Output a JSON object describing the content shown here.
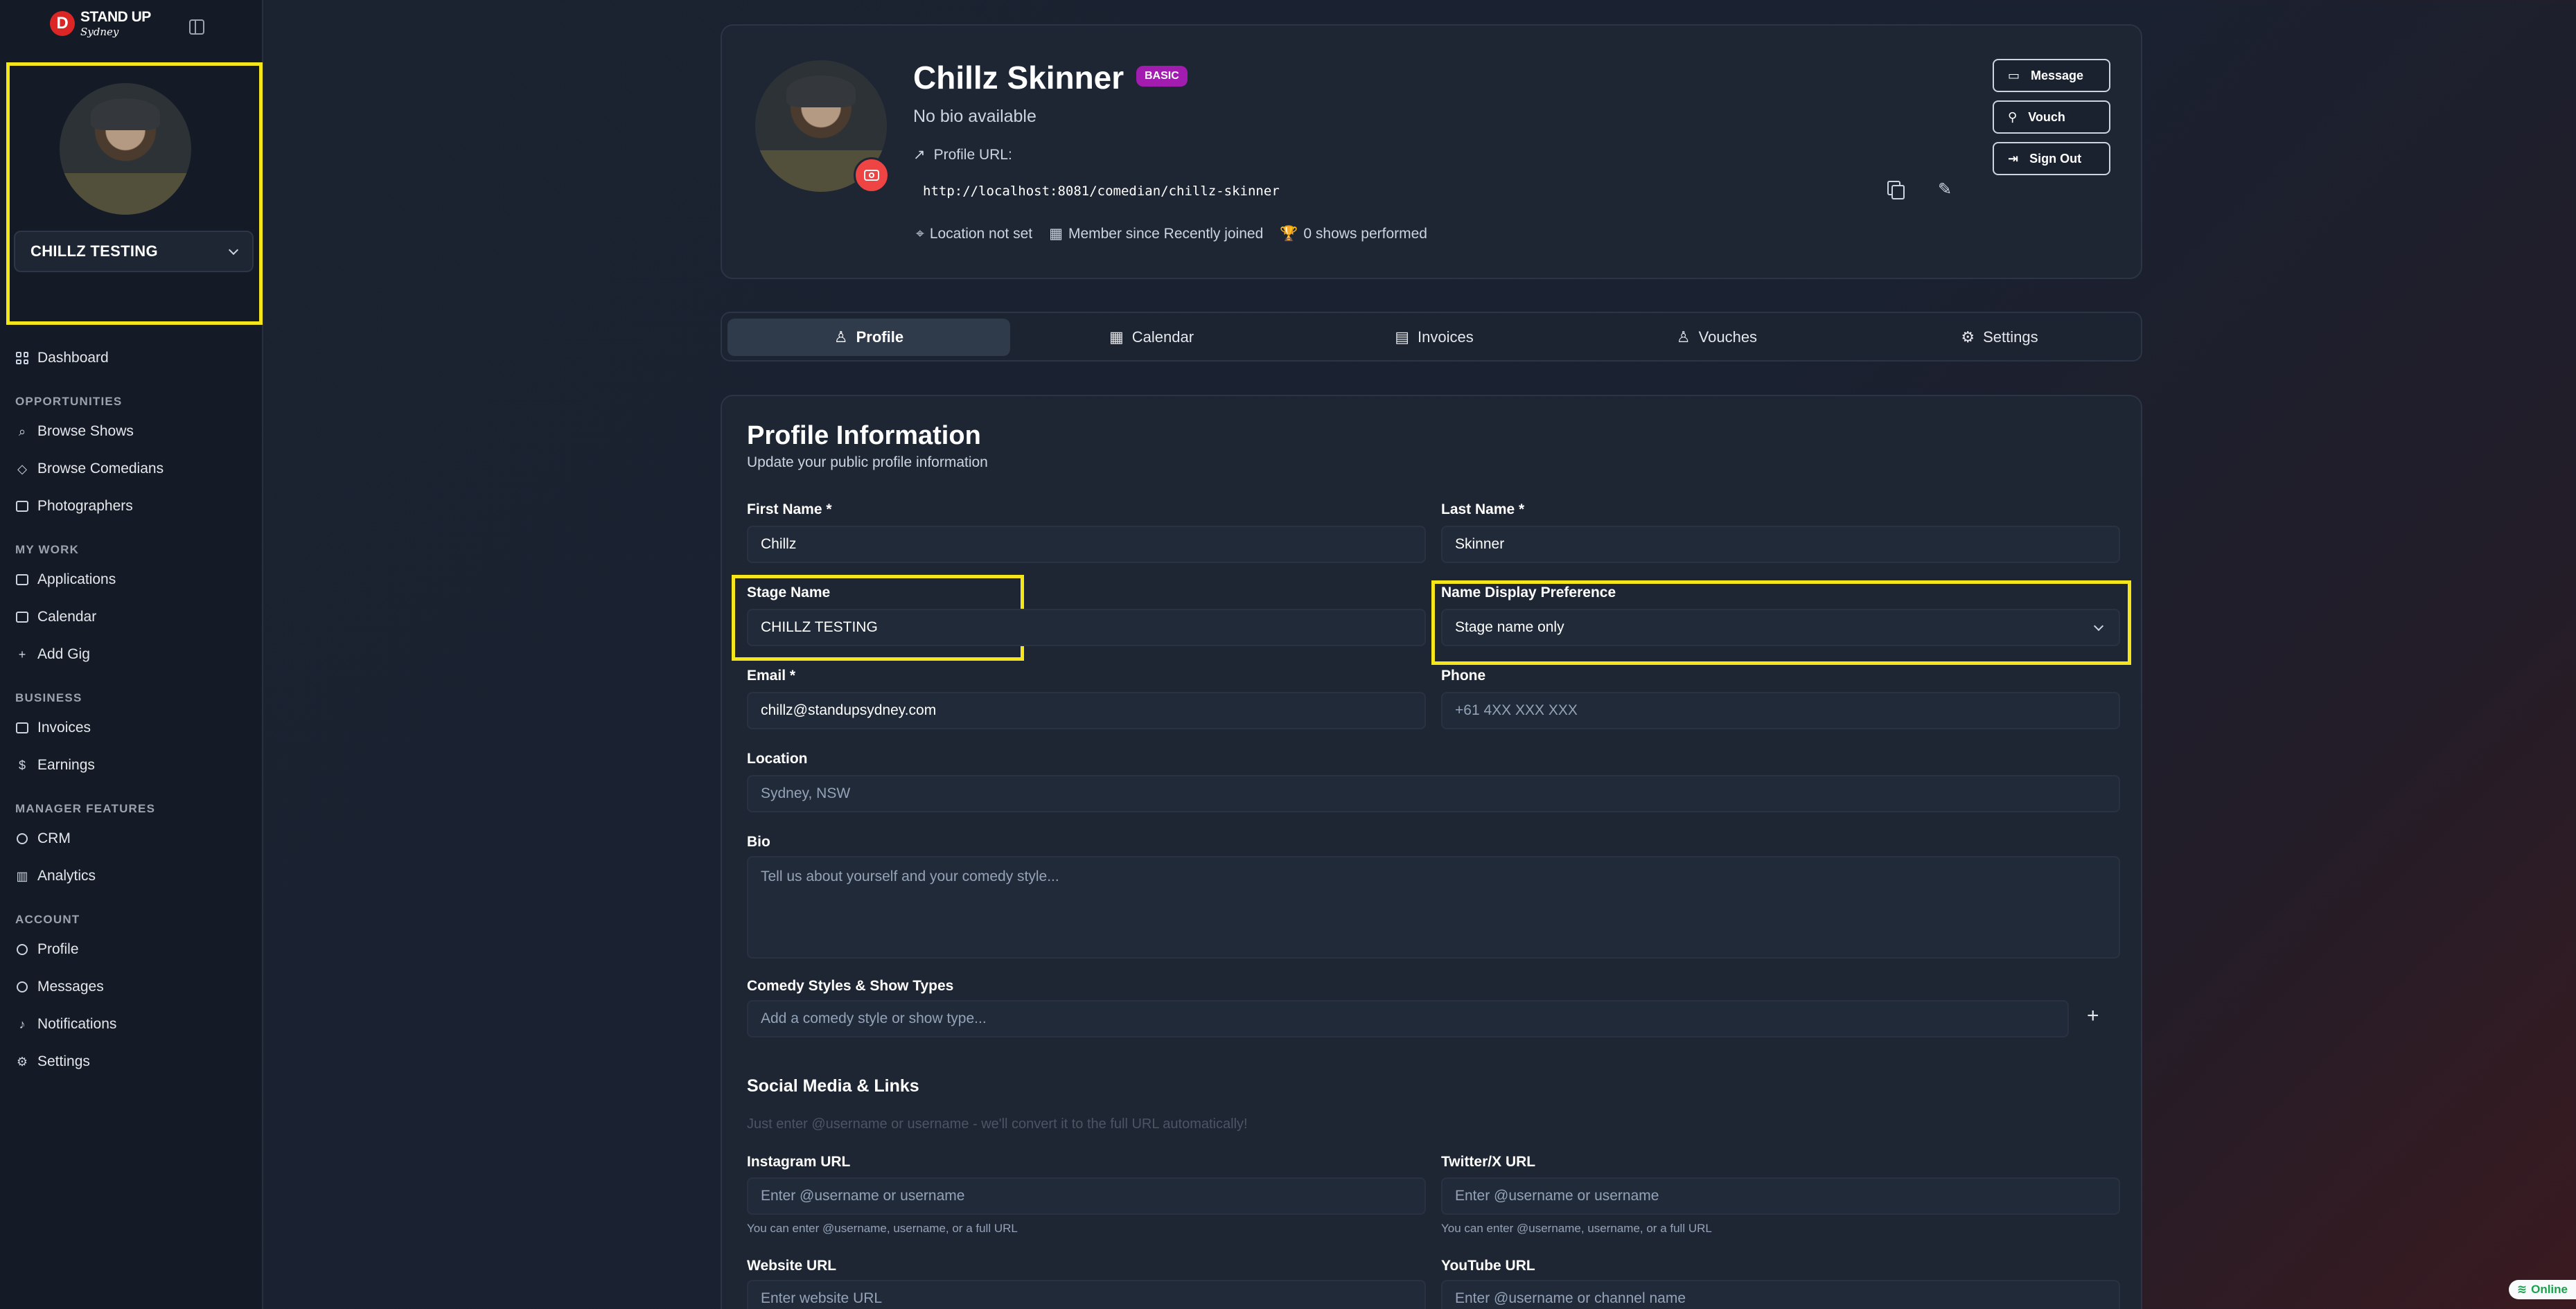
{
  "brand": {
    "badge": "D",
    "line1": "STAND UP",
    "line2": "Sydney"
  },
  "sidebar": {
    "user_name": "CHILLZ TESTING",
    "dashboard": "Dashboard",
    "sections": [
      {
        "title": "OPPORTUNITIES",
        "items": [
          "Browse Shows",
          "Browse Comedians",
          "Photographers"
        ]
      },
      {
        "title": "MY WORK",
        "items": [
          "Applications",
          "Calendar",
          "Add Gig"
        ]
      },
      {
        "title": "BUSINESS",
        "items": [
          "Invoices",
          "Earnings"
        ]
      },
      {
        "title": "MANAGER FEATURES",
        "items": [
          "CRM",
          "Analytics"
        ]
      },
      {
        "title": "ACCOUNT",
        "items": [
          "Profile",
          "Messages",
          "Notifications",
          "Settings"
        ]
      }
    ]
  },
  "profile": {
    "name": "Chillz Skinner",
    "badge": "BASIC",
    "bio": "No bio available",
    "url_label": "Profile URL:",
    "url": "http://localhost:8081/comedian/chillz-skinner",
    "location": "Location not set",
    "member_since": "Member since Recently joined",
    "shows": "0 shows performed",
    "buttons": {
      "message": "Message",
      "vouch": "Vouch",
      "sign_out": "Sign Out"
    }
  },
  "tabs": [
    "Profile",
    "Calendar",
    "Invoices",
    "Vouches",
    "Settings"
  ],
  "form": {
    "title": "Profile Information",
    "subtitle": "Update your public profile information",
    "first_name": {
      "label": "First Name *",
      "value": "Chillz"
    },
    "last_name": {
      "label": "Last Name *",
      "value": "Skinner"
    },
    "stage_name": {
      "label": "Stage Name",
      "value": "CHILLZ TESTING"
    },
    "name_display": {
      "label": "Name Display Preference",
      "value": "Stage name only"
    },
    "email": {
      "label": "Email *",
      "value": "chillz@standupsydney.com"
    },
    "phone": {
      "label": "Phone",
      "placeholder": "+61 4XX XXX XXX"
    },
    "location": {
      "label": "Location",
      "placeholder": "Sydney, NSW"
    },
    "bio": {
      "label": "Bio",
      "placeholder": "Tell us about yourself and your comedy style..."
    },
    "styles": {
      "label": "Comedy Styles & Show Types",
      "placeholder": "Add a comedy style or show type..."
    },
    "social": {
      "title": "Social Media & Links",
      "hint": "Just enter @username or username - we'll convert it to the full URL automatically!",
      "instagram": {
        "label": "Instagram URL",
        "placeholder": "Enter @username or username",
        "hint": "You can enter @username, username, or a full URL"
      },
      "twitter": {
        "label": "Twitter/X URL",
        "placeholder": "Enter @username or username",
        "hint": "You can enter @username, username, or a full URL"
      },
      "website": {
        "label": "Website URL",
        "placeholder": "Enter website URL"
      },
      "youtube": {
        "label": "YouTube URL",
        "placeholder": "Enter @username or channel name"
      }
    }
  },
  "status": {
    "online": "Online"
  },
  "colors": {
    "accent_badge": "#a21caf",
    "camera": "#ef4444",
    "highlight": "#f5e51b",
    "online": "#16a34a"
  }
}
